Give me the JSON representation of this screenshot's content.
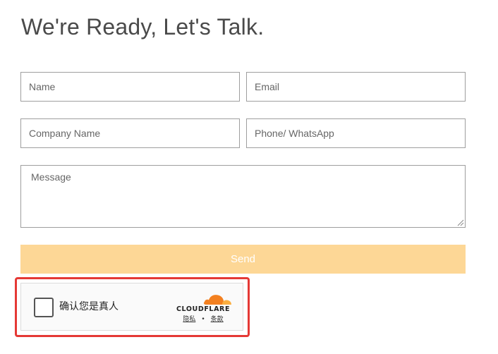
{
  "page": {
    "title": "We're Ready, Let's Talk."
  },
  "form": {
    "name_placeholder": "Name",
    "email_placeholder": "Email",
    "company_placeholder": "Company Name",
    "phone_placeholder": "Phone/ WhatsApp",
    "message_placeholder": "Message",
    "send_label": "Send"
  },
  "captcha": {
    "label": "确认您是真人",
    "brand": "CLOUDFLARE",
    "privacy_link": "隐私",
    "separator": "•",
    "terms_link": "条款",
    "checked": false
  },
  "colors": {
    "send_button": "#fdd796",
    "highlight_border": "#e53935",
    "cloudflare_orange": "#f38020",
    "cloudflare_light_orange": "#faae40"
  },
  "icons": {
    "cloudflare_logo": "cloudflare-cloud-icon",
    "resize_grip": "resize-grip-icon"
  }
}
